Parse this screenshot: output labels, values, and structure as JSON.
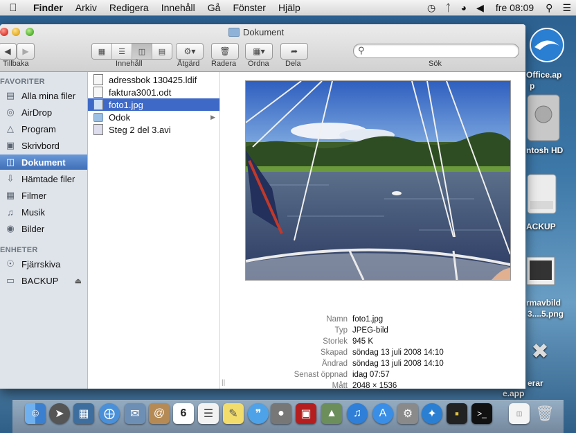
{
  "menubar": {
    "app_name": "Finder",
    "items": [
      "Arkiv",
      "Redigera",
      "Innehåll",
      "Gå",
      "Fönster",
      "Hjälp"
    ],
    "clock": "fre 08:09"
  },
  "desktop": {
    "labels": [
      "Office.ap",
      "p",
      "ntosh HD",
      "ACKUP",
      "rmavbild",
      "3....5.png",
      "erar",
      "e.app"
    ]
  },
  "window": {
    "title": "Dokument",
    "toolbar": {
      "back_label": "Tillbaka",
      "view_label": "Innehåll",
      "action_label": "Åtgärd",
      "delete_label": "Radera",
      "arrange_label": "Ordna",
      "share_label": "Dela",
      "search_label": "Sök",
      "search_value": ""
    },
    "sidebar": {
      "favorites_header": "FAVORITER",
      "favorites": [
        {
          "label": "Alla mina filer",
          "icon": "all-files-icon"
        },
        {
          "label": "AirDrop",
          "icon": "airdrop-icon"
        },
        {
          "label": "Program",
          "icon": "applications-icon"
        },
        {
          "label": "Skrivbord",
          "icon": "desktop-icon"
        },
        {
          "label": "Dokument",
          "icon": "documents-icon"
        },
        {
          "label": "Hämtade filer",
          "icon": "downloads-icon"
        },
        {
          "label": "Filmer",
          "icon": "movies-icon"
        },
        {
          "label": "Musik",
          "icon": "music-icon"
        },
        {
          "label": "Bilder",
          "icon": "pictures-icon"
        }
      ],
      "devices_header": "ENHETER",
      "devices": [
        {
          "label": "Fjärrskiva",
          "icon": "remote-disc-icon"
        },
        {
          "label": "BACKUP",
          "icon": "drive-icon"
        }
      ]
    },
    "files": [
      {
        "name": "adressbok 130425.ldif",
        "kind": "file"
      },
      {
        "name": "faktura3001.odt",
        "kind": "file"
      },
      {
        "name": "foto1.jpg",
        "kind": "image"
      },
      {
        "name": "Odok",
        "kind": "folder"
      },
      {
        "name": "Steg 2 del 3.avi",
        "kind": "video"
      }
    ],
    "info": {
      "name_key": "Namn",
      "name_value": "foto1.jpg",
      "type_key": "Typ",
      "type_value": "JPEG-bild",
      "size_key": "Storlek",
      "size_value": "945 K",
      "created_key": "Skapad",
      "created_value": "söndag 13 juli 2008 14:10",
      "modified_key": "Ändrad",
      "modified_value": "söndag 13 juli 2008 14:10",
      "opened_key": "Senast öppnad",
      "opened_value": "idag 07:57",
      "dims_key": "Mått",
      "dims_value": "2048 × 1536"
    }
  },
  "dock": {
    "calendar_day": "6"
  },
  "colors": {
    "selection": "#3f69c6",
    "sidebar_bg": "#dfe4ea"
  }
}
